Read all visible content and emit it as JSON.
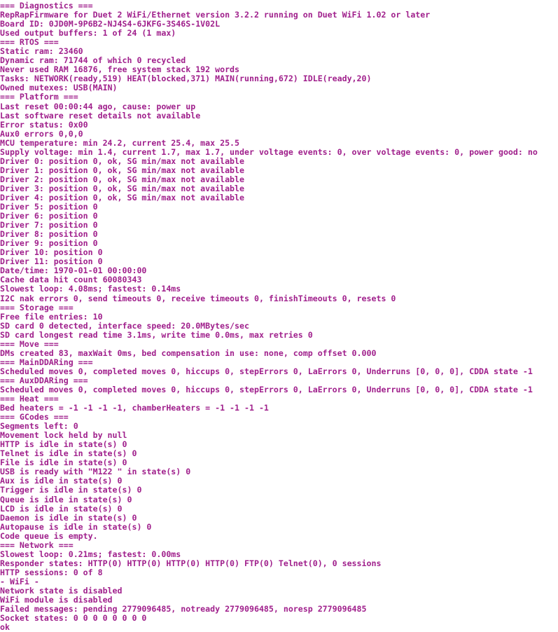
{
  "console": {
    "background_color": "#ffffff",
    "text_color": "#a0208c",
    "lines": [
      "=== Diagnostics ===",
      "RepRapFirmware for Duet 2 WiFi/Ethernet version 3.2.2 running on Duet WiFi 1.02 or later",
      "Board ID: 0JD0M-9P6B2-NJ4S4-6JKFG-3S46S-1V02L",
      "Used output buffers: 1 of 24 (1 max)",
      "=== RTOS ===",
      "Static ram: 23460",
      "Dynamic ram: 71744 of which 0 recycled",
      "Never used RAM 16876, free system stack 192 words",
      "Tasks: NETWORK(ready,519) HEAT(blocked,371) MAIN(running,672) IDLE(ready,20)",
      "Owned mutexes: USB(MAIN)",
      "=== Platform ===",
      "Last reset 00:00:44 ago, cause: power up",
      "Last software reset details not available",
      "Error status: 0x00",
      "Aux0 errors 0,0,0",
      "MCU temperature: min 24.2, current 25.4, max 25.5",
      "Supply voltage: min 1.4, current 1.7, max 1.7, under voltage events: 0, over voltage events: 0, power good: no",
      "Driver 0: position 0, ok, SG min/max not available",
      "Driver 1: position 0, ok, SG min/max not available",
      "Driver 2: position 0, ok, SG min/max not available",
      "Driver 3: position 0, ok, SG min/max not available",
      "Driver 4: position 0, ok, SG min/max not available",
      "Driver 5: position 0",
      "Driver 6: position 0",
      "Driver 7: position 0",
      "Driver 8: position 0",
      "Driver 9: position 0",
      "Driver 10: position 0",
      "Driver 11: position 0",
      "Date/time: 1970-01-01 00:00:00",
      "Cache data hit count 60080343",
      "Slowest loop: 4.08ms; fastest: 0.14ms",
      "I2C nak errors 0, send timeouts 0, receive timeouts 0, finishTimeouts 0, resets 0",
      "=== Storage ===",
      "Free file entries: 10",
      "SD card 0 detected, interface speed: 20.0MBytes/sec",
      "SD card longest read time 3.1ms, write time 0.0ms, max retries 0",
      "=== Move ===",
      "DMs created 83, maxWait 0ms, bed compensation in use: none, comp offset 0.000",
      "=== MainDDARing ===",
      "Scheduled moves 0, completed moves 0, hiccups 0, stepErrors 0, LaErrors 0, Underruns [0, 0, 0], CDDA state -1",
      "=== AuxDDARing ===",
      "Scheduled moves 0, completed moves 0, hiccups 0, stepErrors 0, LaErrors 0, Underruns [0, 0, 0], CDDA state -1",
      "=== Heat ===",
      "Bed heaters = -1 -1 -1 -1, chamberHeaters = -1 -1 -1 -1",
      "=== GCodes ===",
      "Segments left: 0",
      "Movement lock held by null",
      "HTTP is idle in state(s) 0",
      "Telnet is idle in state(s) 0",
      "File is idle in state(s) 0",
      "USB is ready with \"M122 \" in state(s) 0",
      "Aux is idle in state(s) 0",
      "Trigger is idle in state(s) 0",
      "Queue is idle in state(s) 0",
      "LCD is idle in state(s) 0",
      "Daemon is idle in state(s) 0",
      "Autopause is idle in state(s) 0",
      "Code queue is empty.",
      "=== Network ===",
      "Slowest loop: 0.21ms; fastest: 0.00ms",
      "Responder states: HTTP(0) HTTP(0) HTTP(0) HTTP(0) FTP(0) Telnet(0), 0 sessions",
      "HTTP sessions: 0 of 8",
      "- WiFi -",
      "Network state is disabled",
      "WiFi module is disabled",
      "Failed messages: pending 2779096485, notready 2779096485, noresp 2779096485",
      "Socket states: 0 0 0 0 0 0 0 0",
      "ok"
    ]
  }
}
